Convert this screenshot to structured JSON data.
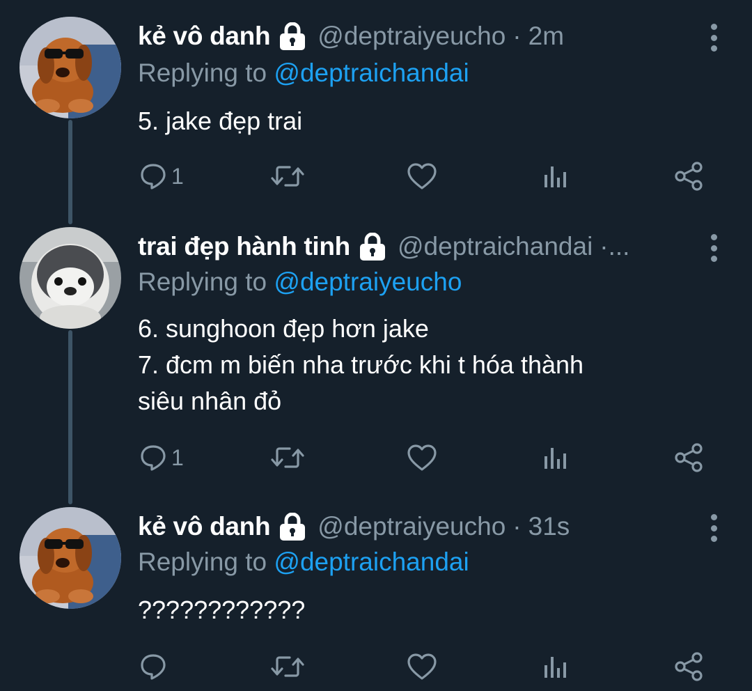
{
  "colors": {
    "background": "#15202b",
    "secondary_text": "#8899a6",
    "accent": "#1da1f2",
    "thread_line": "#3d5466"
  },
  "tweets": [
    {
      "name": "kẻ vô danh",
      "handle": "@deptraiyeucho",
      "separator": "·",
      "time": "2m",
      "replying_label": "Replying to",
      "replying_to": "@deptraichandai",
      "text": "5. jake đẹp trai",
      "reply_count": "1",
      "avatar": "dachshund-sunglasses",
      "protected": true
    },
    {
      "name": "trai đẹp hành tinh",
      "handle": "@deptraichandai",
      "separator": "·...",
      "time": "",
      "replying_label": "Replying to",
      "replying_to": "@deptraiyeucho",
      "text": "6. sunghoon đẹp hơn jake\n7. đcm m biến nha trước khi t hóa thành\nsiêu nhân đỏ",
      "reply_count": "1",
      "avatar": "baby-penguin",
      "protected": true
    },
    {
      "name": "kẻ vô danh",
      "handle": "@deptraiyeucho",
      "separator": "·",
      "time": "31s",
      "replying_label": "Replying to",
      "replying_to": "@deptraichandai",
      "text": "????????????",
      "reply_count": "",
      "avatar": "dachshund-sunglasses",
      "protected": true
    }
  ]
}
